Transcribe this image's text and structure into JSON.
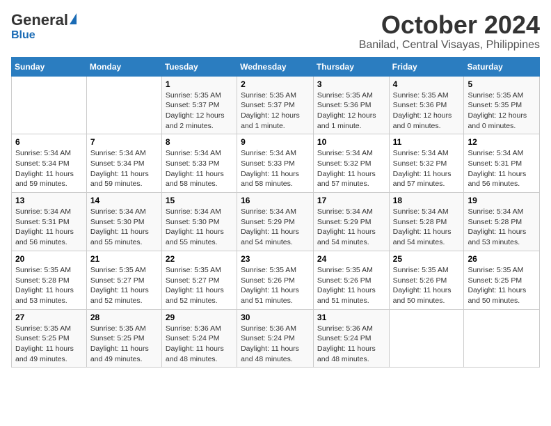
{
  "logo": {
    "general": "General",
    "blue": "Blue"
  },
  "title": "October 2024",
  "subtitle": "Banilad, Central Visayas, Philippines",
  "days_of_week": [
    "Sunday",
    "Monday",
    "Tuesday",
    "Wednesday",
    "Thursday",
    "Friday",
    "Saturday"
  ],
  "weeks": [
    [
      {
        "day": "",
        "info": ""
      },
      {
        "day": "",
        "info": ""
      },
      {
        "day": "1",
        "info": "Sunrise: 5:35 AM\nSunset: 5:37 PM\nDaylight: 12 hours\nand 2 minutes."
      },
      {
        "day": "2",
        "info": "Sunrise: 5:35 AM\nSunset: 5:37 PM\nDaylight: 12 hours\nand 1 minute."
      },
      {
        "day": "3",
        "info": "Sunrise: 5:35 AM\nSunset: 5:36 PM\nDaylight: 12 hours\nand 1 minute."
      },
      {
        "day": "4",
        "info": "Sunrise: 5:35 AM\nSunset: 5:36 PM\nDaylight: 12 hours\nand 0 minutes."
      },
      {
        "day": "5",
        "info": "Sunrise: 5:35 AM\nSunset: 5:35 PM\nDaylight: 12 hours\nand 0 minutes."
      }
    ],
    [
      {
        "day": "6",
        "info": "Sunrise: 5:34 AM\nSunset: 5:34 PM\nDaylight: 11 hours\nand 59 minutes."
      },
      {
        "day": "7",
        "info": "Sunrise: 5:34 AM\nSunset: 5:34 PM\nDaylight: 11 hours\nand 59 minutes."
      },
      {
        "day": "8",
        "info": "Sunrise: 5:34 AM\nSunset: 5:33 PM\nDaylight: 11 hours\nand 58 minutes."
      },
      {
        "day": "9",
        "info": "Sunrise: 5:34 AM\nSunset: 5:33 PM\nDaylight: 11 hours\nand 58 minutes."
      },
      {
        "day": "10",
        "info": "Sunrise: 5:34 AM\nSunset: 5:32 PM\nDaylight: 11 hours\nand 57 minutes."
      },
      {
        "day": "11",
        "info": "Sunrise: 5:34 AM\nSunset: 5:32 PM\nDaylight: 11 hours\nand 57 minutes."
      },
      {
        "day": "12",
        "info": "Sunrise: 5:34 AM\nSunset: 5:31 PM\nDaylight: 11 hours\nand 56 minutes."
      }
    ],
    [
      {
        "day": "13",
        "info": "Sunrise: 5:34 AM\nSunset: 5:31 PM\nDaylight: 11 hours\nand 56 minutes."
      },
      {
        "day": "14",
        "info": "Sunrise: 5:34 AM\nSunset: 5:30 PM\nDaylight: 11 hours\nand 55 minutes."
      },
      {
        "day": "15",
        "info": "Sunrise: 5:34 AM\nSunset: 5:30 PM\nDaylight: 11 hours\nand 55 minutes."
      },
      {
        "day": "16",
        "info": "Sunrise: 5:34 AM\nSunset: 5:29 PM\nDaylight: 11 hours\nand 54 minutes."
      },
      {
        "day": "17",
        "info": "Sunrise: 5:34 AM\nSunset: 5:29 PM\nDaylight: 11 hours\nand 54 minutes."
      },
      {
        "day": "18",
        "info": "Sunrise: 5:34 AM\nSunset: 5:28 PM\nDaylight: 11 hours\nand 54 minutes."
      },
      {
        "day": "19",
        "info": "Sunrise: 5:34 AM\nSunset: 5:28 PM\nDaylight: 11 hours\nand 53 minutes."
      }
    ],
    [
      {
        "day": "20",
        "info": "Sunrise: 5:35 AM\nSunset: 5:28 PM\nDaylight: 11 hours\nand 53 minutes."
      },
      {
        "day": "21",
        "info": "Sunrise: 5:35 AM\nSunset: 5:27 PM\nDaylight: 11 hours\nand 52 minutes."
      },
      {
        "day": "22",
        "info": "Sunrise: 5:35 AM\nSunset: 5:27 PM\nDaylight: 11 hours\nand 52 minutes."
      },
      {
        "day": "23",
        "info": "Sunrise: 5:35 AM\nSunset: 5:26 PM\nDaylight: 11 hours\nand 51 minutes."
      },
      {
        "day": "24",
        "info": "Sunrise: 5:35 AM\nSunset: 5:26 PM\nDaylight: 11 hours\nand 51 minutes."
      },
      {
        "day": "25",
        "info": "Sunrise: 5:35 AM\nSunset: 5:26 PM\nDaylight: 11 hours\nand 50 minutes."
      },
      {
        "day": "26",
        "info": "Sunrise: 5:35 AM\nSunset: 5:25 PM\nDaylight: 11 hours\nand 50 minutes."
      }
    ],
    [
      {
        "day": "27",
        "info": "Sunrise: 5:35 AM\nSunset: 5:25 PM\nDaylight: 11 hours\nand 49 minutes."
      },
      {
        "day": "28",
        "info": "Sunrise: 5:35 AM\nSunset: 5:25 PM\nDaylight: 11 hours\nand 49 minutes."
      },
      {
        "day": "29",
        "info": "Sunrise: 5:36 AM\nSunset: 5:24 PM\nDaylight: 11 hours\nand 48 minutes."
      },
      {
        "day": "30",
        "info": "Sunrise: 5:36 AM\nSunset: 5:24 PM\nDaylight: 11 hours\nand 48 minutes."
      },
      {
        "day": "31",
        "info": "Sunrise: 5:36 AM\nSunset: 5:24 PM\nDaylight: 11 hours\nand 48 minutes."
      },
      {
        "day": "",
        "info": ""
      },
      {
        "day": "",
        "info": ""
      }
    ]
  ]
}
